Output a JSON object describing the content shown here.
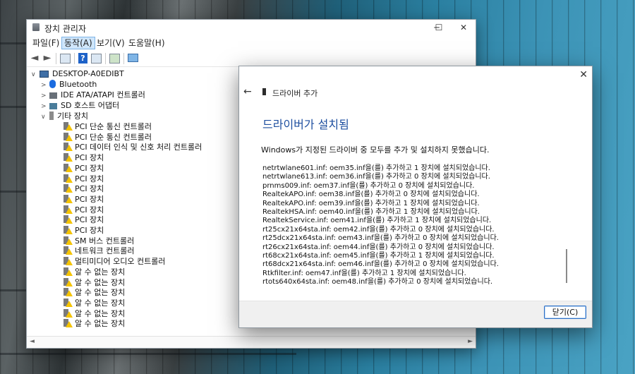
{
  "device_manager": {
    "title": "장치 관리자",
    "window_controls": {
      "minimize": "─",
      "maximize": "☐",
      "close": "✕"
    },
    "menu": [
      "파일(F)",
      "동작(A)",
      "보기(V)",
      "도움말(H)"
    ],
    "active_menu": "동작(A)",
    "toolbar": {
      "back": "◄",
      "forward": "►",
      "help": "?"
    },
    "tree": {
      "root": "DESKTOP-A0EDIBT",
      "categories": [
        "Bluetooth",
        "IDE ATA/ATAPI 컨트롤러",
        "SD 호스트 어댑터"
      ],
      "other_devices": {
        "label": "기타 장치",
        "items": [
          "PCI 단순 통신 컨트롤러",
          "PCI 단순 통신 컨트롤러",
          "PCI 데이터 인식 및 신호 처리 컨트롤러",
          "PCI 장치",
          "PCI 장치",
          "PCI 장치",
          "PCI 장치",
          "PCI 장치",
          "PCI 장치",
          "PCI 장치",
          "PCI 장치",
          "SM 버스 컨트롤러",
          "네트워크 컨트롤러",
          "멀티미디어 오디오 컨트롤러",
          "알 수 없는 장치",
          "알 수 없는 장치",
          "알 수 없는 장치",
          "알 수 없는 장치",
          "알 수 없는 장치",
          "알 수 없는 장치"
        ]
      }
    }
  },
  "driver_dialog": {
    "close": "✕",
    "back": "←",
    "header": "드라이버 추가",
    "heading": "드라이버가 설치됨",
    "message": "Windows가 지정된 드라이버 중 모두를 추가 및 설치하지 못했습니다.",
    "results": [
      "netrtwlane601.inf: oem35.inf을(를) 추가하고 1 장치에 설치되었습니다.",
      "netrtwlane613.inf: oem36.inf을(를) 추가하고 0 장치에 설치되었습니다.",
      "prnms009.inf: oem37.inf을(를) 추가하고 0 장치에 설치되었습니다.",
      "RealtekAPO.inf: oem38.inf을(를) 추가하고 0 장치에 설치되었습니다.",
      "RealtekAPO.inf: oem39.inf을(를) 추가하고 1 장치에 설치되었습니다.",
      "RealtekHSA.inf: oem40.inf을(를) 추가하고 1 장치에 설치되었습니다.",
      "RealtekService.inf: oem41.inf을(를) 추가하고 1 장치에 설치되었습니다.",
      "rt25cx21x64sta.inf: oem42.inf을(를) 추가하고 0 장치에 설치되었습니다.",
      "rt25dcx21x64sta.inf: oem43.inf을(를) 추가하고 0 장치에 설치되었습니다.",
      "rt26cx21x64sta.inf: oem44.inf을(를) 추가하고 0 장치에 설치되었습니다.",
      "rt68cx21x64sta.inf: oem45.inf을(를) 추가하고 1 장치에 설치되었습니다.",
      "rt68dcx21x64sta.inf: oem46.inf을(를) 추가하고 0 장치에 설치되었습니다.",
      "Rtkfilter.inf: oem47.inf을(를) 추가하고 1 장치에 설치되었습니다.",
      "rtots640x64sta.inf: oem48.inf을(를) 추가하고 0 장치에 설치되었습니다."
    ],
    "close_button": "닫기(C)",
    "accent_color": "#1d4e9f"
  }
}
